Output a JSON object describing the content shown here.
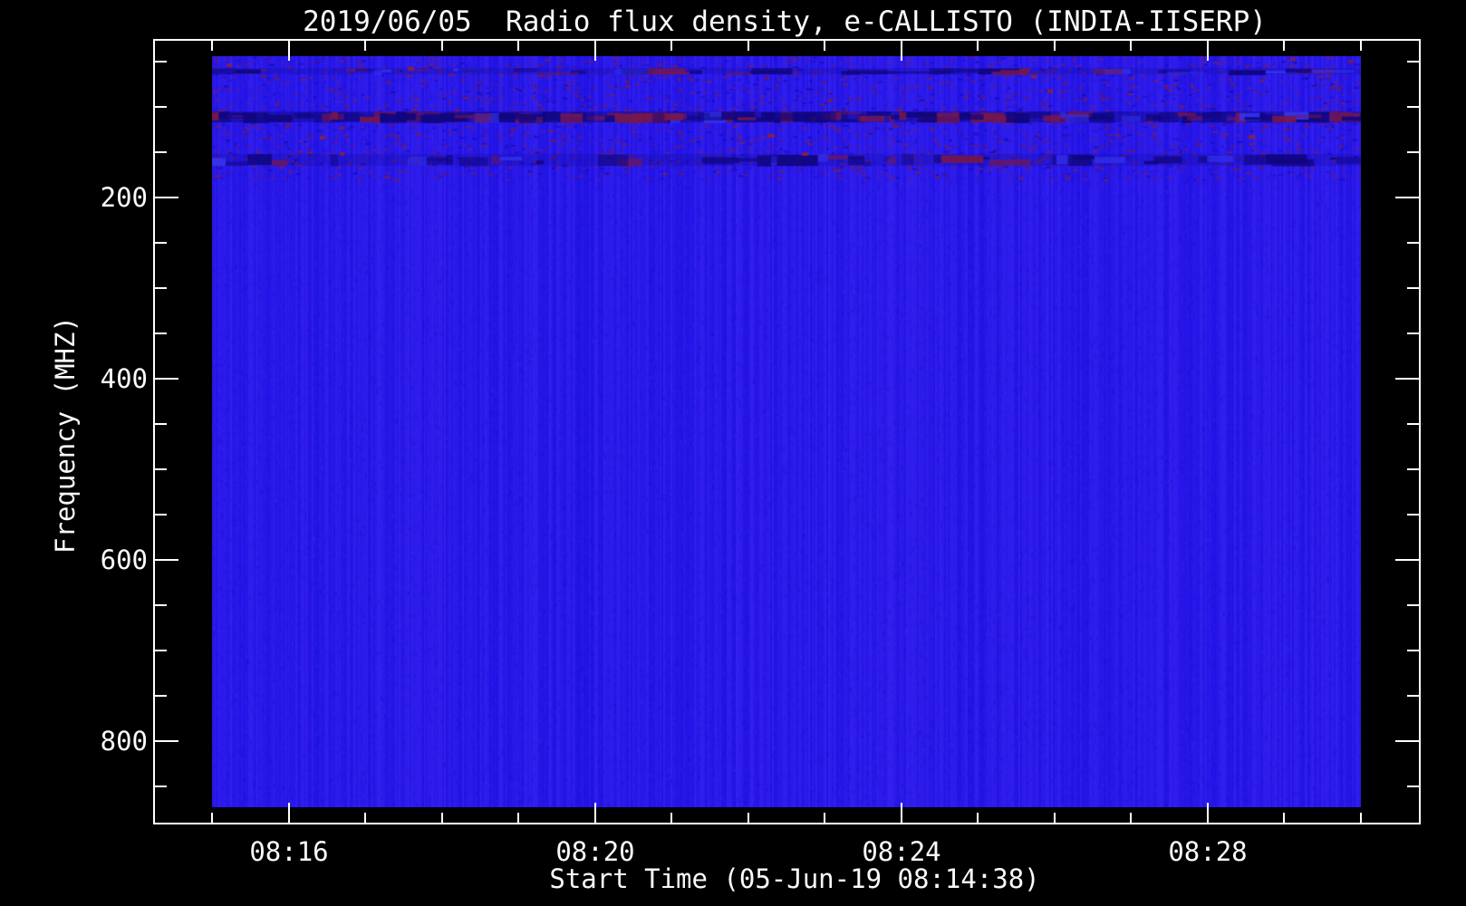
{
  "page": {
    "background_color": "#000000",
    "text_color": "#fafafa",
    "frame_color": "#ffffff"
  },
  "chart_data": {
    "type": "heatmap",
    "title": "2019/06/05  Radio flux density, e-CALLISTO (INDIA-IISERP)",
    "xlabel": "Start Time (05-Jun-19 08:14:38)",
    "ylabel": "Frequency (MHZ)",
    "legend": "none",
    "grid": "off",
    "x_axis": {
      "tick_labels": [
        "08:16",
        "08:20",
        "08:24",
        "08:28"
      ],
      "major_tick_minutes": [
        16,
        20,
        24,
        28
      ],
      "minor_tick_minutes": [
        15,
        16,
        17,
        18,
        19,
        20,
        21,
        22,
        23,
        24,
        25,
        26,
        27,
        28,
        29,
        30
      ],
      "start_time_label": "08:14:38"
    },
    "y_axis": {
      "tick_labels": [
        "200",
        "400",
        "600",
        "800"
      ],
      "major_tick_mhz": [
        200,
        400,
        600,
        800
      ],
      "minor_tick_step_mhz": 50,
      "minor_tick_range_mhz": [
        50,
        850
      ],
      "direction": "increasing downward"
    },
    "spectrogram": {
      "freq_span_mhz": [
        44,
        872
      ],
      "base_color": "#2a19e9",
      "speckle_freq_range_mhz": [
        44,
        180
      ],
      "speckle_colors": [
        "#78184a",
        "#5c2090",
        "#140ab4",
        "#8c2030"
      ],
      "band_colors": {
        "navy": "#10067e",
        "maroon": "#78184a",
        "bright": "#3434f2"
      },
      "rfi_bands": [
        {
          "freq_mhz": [
            57,
            64
          ],
          "strength": "medium"
        },
        {
          "freq_mhz": [
            105,
            117
          ],
          "strength": "strong"
        },
        {
          "freq_mhz": [
            152,
            165
          ],
          "strength": "medium"
        }
      ],
      "overall": "uniform quiet blue background, narrowband RFI speckle near top only"
    }
  }
}
